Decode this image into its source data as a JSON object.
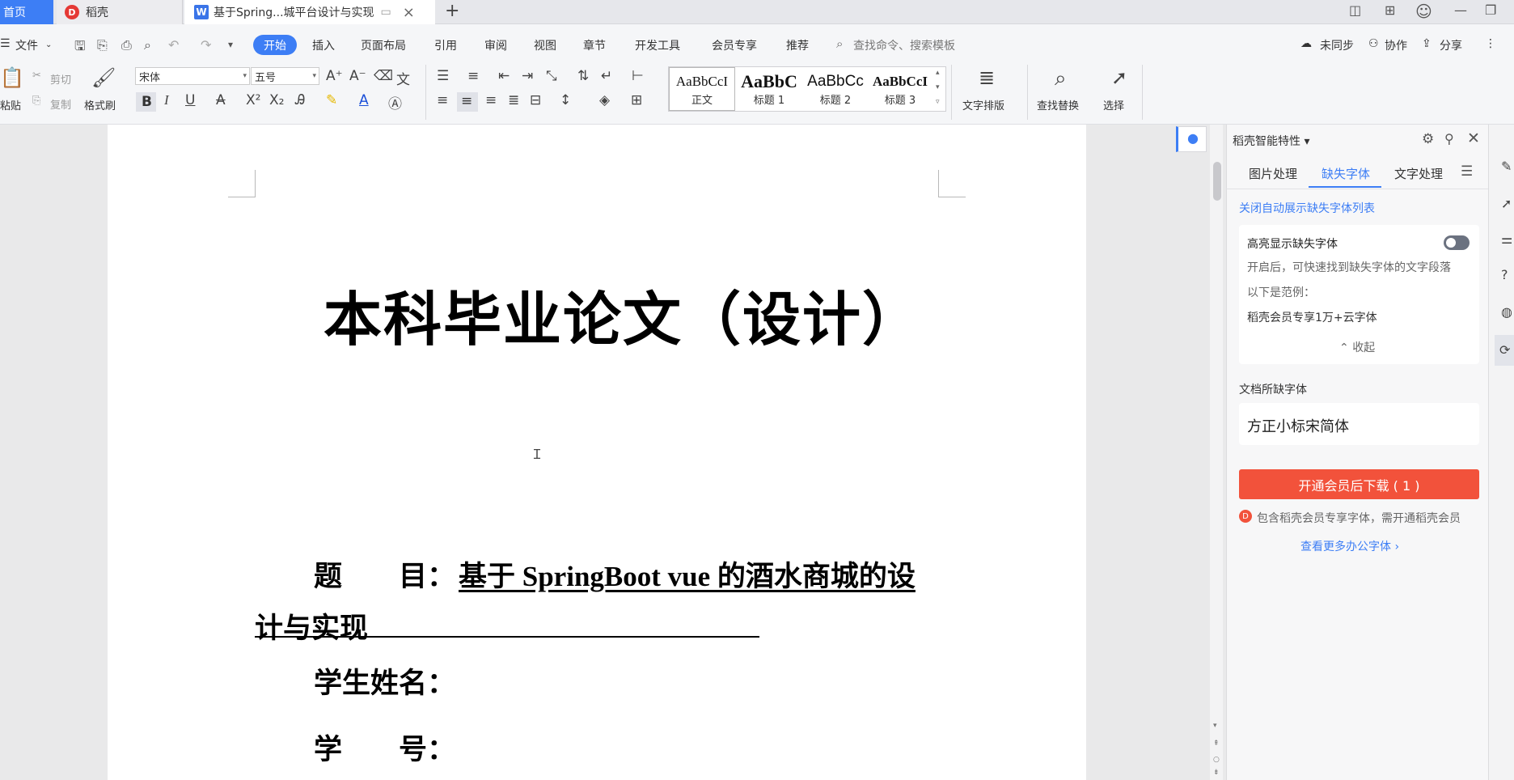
{
  "tabs": {
    "home": "首页",
    "daoke": "稻壳",
    "doc": "基于Spring...城平台设计与实现"
  },
  "menu": {
    "file": "文件",
    "start": "开始",
    "insert": "插入",
    "layout": "页面布局",
    "reference": "引用",
    "review": "审阅",
    "view": "视图",
    "chapter": "章节",
    "devtools": "开发工具",
    "member": "会员专享",
    "recommend": "推荐",
    "search_placeholder": "查找命令、搜索模板",
    "unsync": "未同步",
    "collab": "协作",
    "share": "分享"
  },
  "ribbon": {
    "paste": "粘贴",
    "cut": "剪切",
    "copy": "复制",
    "format_painter": "格式刷",
    "font_name": "宋体",
    "font_size": "五号",
    "styles": [
      {
        "sample": "AaBbCcI",
        "name": "正文"
      },
      {
        "sample": "AaBbC",
        "name": "标题 1"
      },
      {
        "sample": "AaBbCc",
        "name": "标题 2"
      },
      {
        "sample": "AaBbCcI",
        "name": "标题 3"
      }
    ],
    "text_layout": "文字排版",
    "find_replace": "查找替换",
    "select": "选择"
  },
  "document": {
    "title": "本科毕业论文（设计）",
    "topic_label": "题　　目：",
    "topic_value_line1": "基于 SpringBoot vue 的酒水商城的设",
    "topic_value_line2": "计与实现",
    "student_name_label": "学生姓名：",
    "student_id_label": "学　　号："
  },
  "panel": {
    "header": "稻壳智能特性",
    "tabs": [
      "图片处理",
      "缺失字体",
      "文字处理"
    ],
    "active_tab": "缺失字体",
    "close_auto_link": "关闭自动展示缺失字体列表",
    "highlight_title": "高亮显示缺失字体",
    "highlight_desc": "开启后，可快速找到缺失字体的文字段落",
    "example_label": "以下是范例：",
    "example_text": "稻壳会员专享1万+云字体",
    "collapse": "收起",
    "missing_title": "文档所缺字体",
    "missing_font": "方正小标宋简体",
    "download_button": "开通会员后下载 ( 1 )",
    "member_note": "包含稻壳会员专享字体，需开通稻壳会员",
    "more_fonts": "查看更多办公字体"
  },
  "colors": {
    "accent": "#3d7ef5",
    "download": "#f2523b"
  }
}
